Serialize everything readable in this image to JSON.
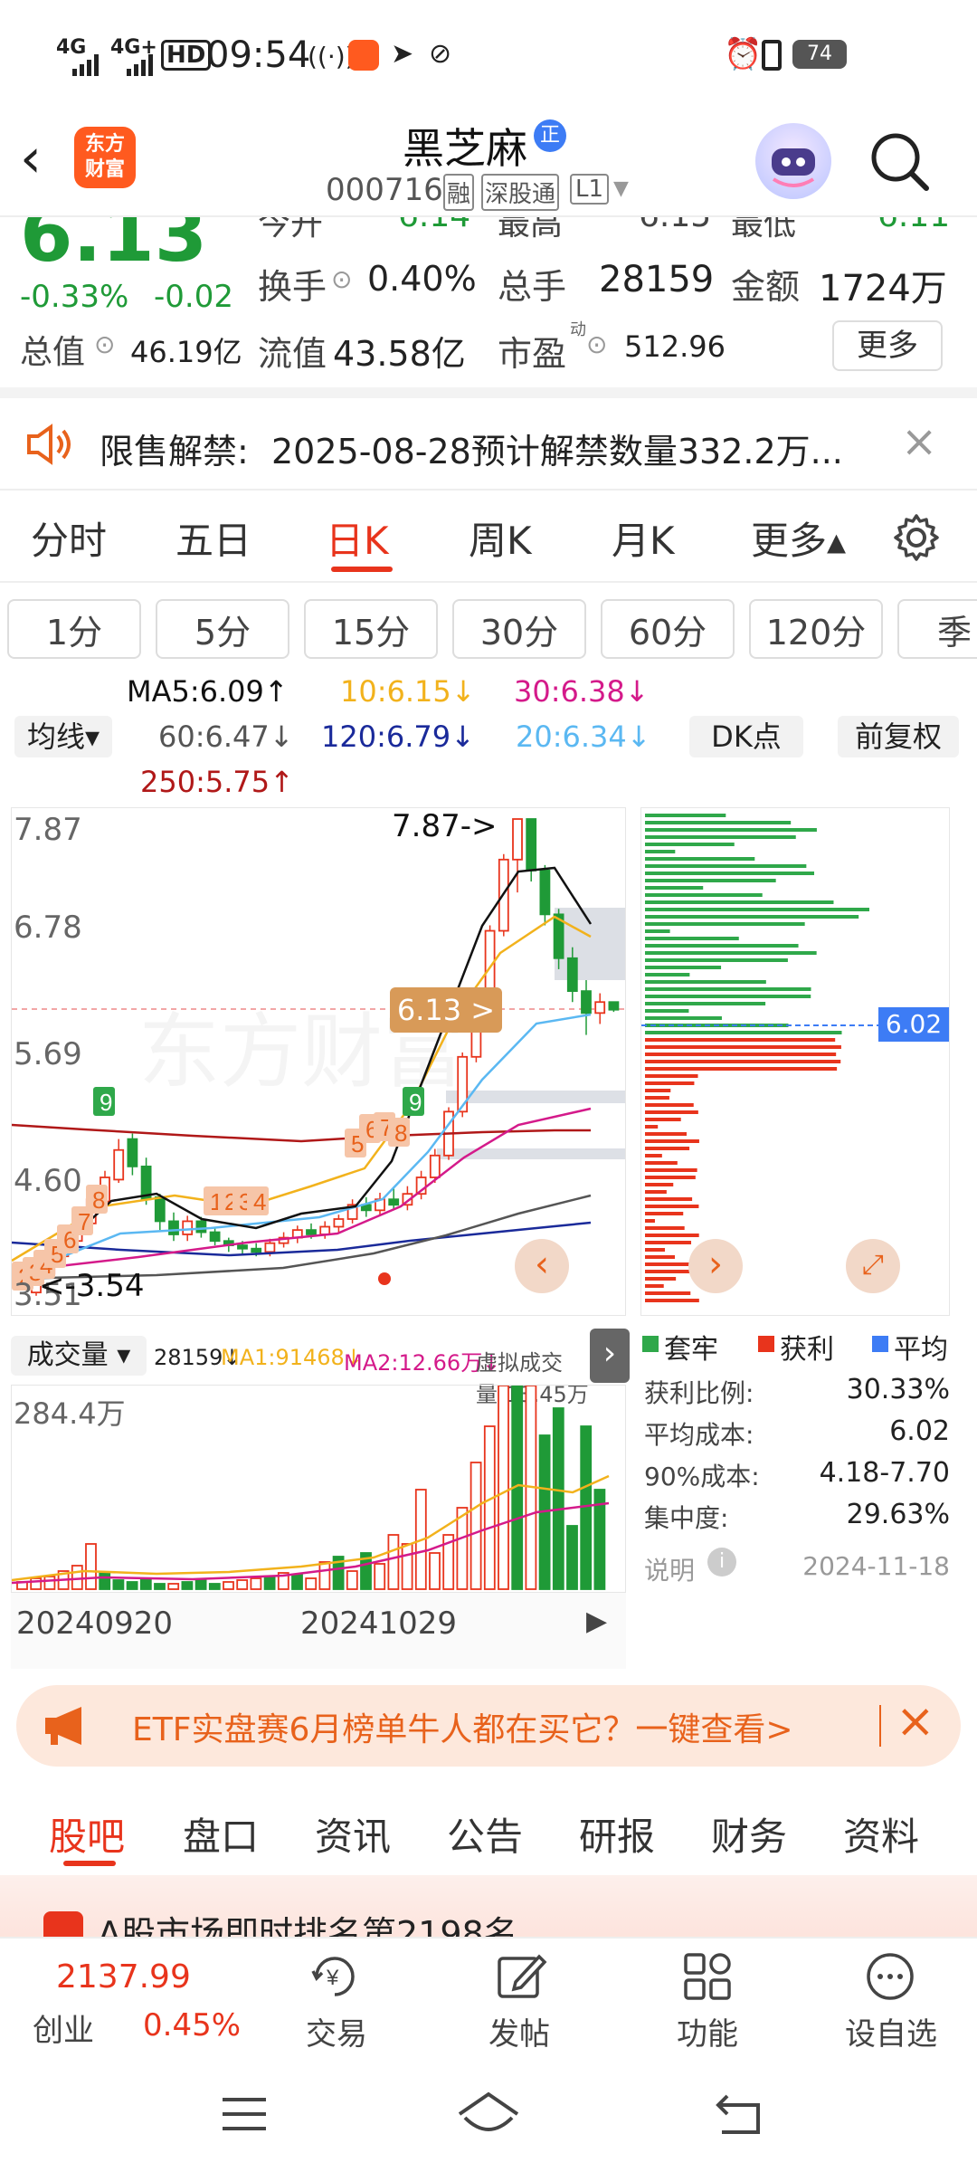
{
  "status_bar": {
    "signal1": "4G",
    "signal2": "4G+",
    "hd": "HD",
    "time": "09:54",
    "battery": "74"
  },
  "header": {
    "title": "黑芝麻",
    "title_badge": "正",
    "code": "000716",
    "tag_rong": "融",
    "tag_shengutong": "深股通",
    "tag_level": "L1"
  },
  "quote": {
    "price": "6.13",
    "change_pct": "-0.33%",
    "change": "-0.02",
    "open_label": "今开",
    "open": "6.14",
    "high_label": "最高",
    "high": "6.15",
    "low_label": "最低",
    "low": "6.11",
    "turnover_label": "换手",
    "turnover": "0.40%",
    "volume_label": "总手",
    "volume": "28159",
    "amount_label": "金额",
    "amount": "1724万",
    "mktcap_label": "总值",
    "mktcap": "46.19亿",
    "float_label": "流值",
    "float": "43.58亿",
    "pe_label": "市盈",
    "pe_sup": "动",
    "pe": "512.96",
    "more_btn": "更多"
  },
  "notice": {
    "label": "限售解禁:",
    "text": "2025-08-28预计解禁数量332.2万..."
  },
  "chart_tabs": [
    {
      "label": "分时"
    },
    {
      "label": "五日"
    },
    {
      "label": "日K"
    },
    {
      "label": "周K"
    },
    {
      "label": "月K"
    },
    {
      "label": "更多▴"
    }
  ],
  "periods": [
    "1分",
    "5分",
    "15分",
    "30分",
    "60分",
    "120分",
    "季"
  ],
  "ma_legend": {
    "selector": "均线▾",
    "ma5": "MA5:6.09↑",
    "ma10": "10:6.15↓",
    "ma30": "30:6.38↓",
    "ma60": "60:6.47↓",
    "ma120": "120:6.79↓",
    "ma20": "20:6.34↓",
    "ma250": "250:5.75↑",
    "dk_btn": "DK点",
    "adjust_btn": "前复权"
  },
  "kline": {
    "y_labels": [
      "7.87",
      "6.78",
      "5.69",
      "4.60",
      "3.51"
    ],
    "high_marker": "7.87->",
    "low_marker": "<-3.54",
    "current_tag": "6.13 >",
    "td_labels": [
      "2",
      "3",
      "4",
      "5",
      "6",
      "7",
      "8",
      "9",
      "1",
      "2",
      "3",
      "4",
      "5",
      "6",
      "7",
      "8",
      "9"
    ],
    "colors": {
      "up": "#e8341c",
      "down": "#1f9a37",
      "ma5": "#111111",
      "ma10": "#f2b21c",
      "ma20": "#5bb8f2",
      "ma30": "#d41a8a",
      "ma60": "#555555",
      "ma120": "#1a2a9a",
      "ma250": "#b01818"
    }
  },
  "chip": {
    "avg_label": "6.02",
    "legend_trapped": "套牢",
    "legend_profit": "获利",
    "legend_avg": "平均",
    "profit_ratio_label": "获利比例:",
    "profit_ratio": "30.33%",
    "avg_cost_label": "平均成本:",
    "avg_cost": "6.02",
    "cost90_label": "90%成本:",
    "cost90": "4.18-7.70",
    "concentration_label": "集中度:",
    "concentration": "29.63%",
    "note_label": "说明",
    "date": "2024-11-18"
  },
  "volume": {
    "selector": "成交量 ▾",
    "vol": "28159↓",
    "ma1": "MA1:91468↓",
    "ma2": "MA2:12.66万↓",
    "virtual": "虚拟成交量:13.45万",
    "y_max": "284.4万",
    "x_start": "20240920",
    "x_mid": "20241029"
  },
  "banner": {
    "text": "ETF实盘赛6月榜单牛人都在买它？一键查看>"
  },
  "bottom_tabs": [
    "股吧",
    "盘口",
    "资讯",
    "公告",
    "研报",
    "财务",
    "资料"
  ],
  "peek_text": "A股市场即时排名第2198名",
  "bottom_nav": {
    "index_value": "2137.99",
    "index_name": "创业",
    "index_change": "0.45%",
    "trade": "交易",
    "post": "发帖",
    "func": "功能",
    "watch": "设自选"
  }
}
